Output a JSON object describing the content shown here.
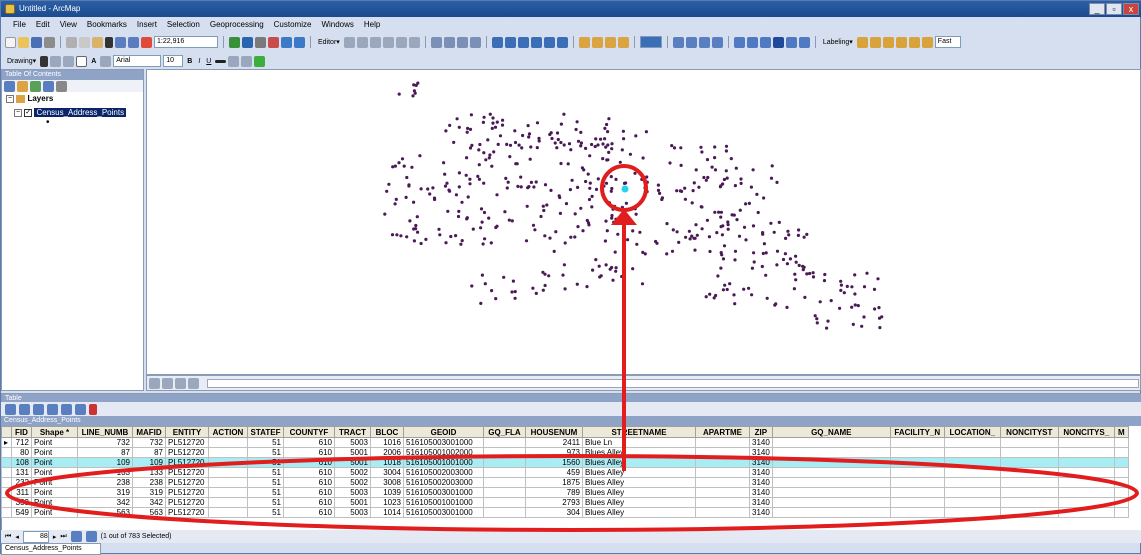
{
  "window": {
    "title": "Untitled - ArcMap",
    "min": "_",
    "max": "▫",
    "close": "x"
  },
  "menu": [
    "File",
    "Edit",
    "View",
    "Bookmarks",
    "Insert",
    "Selection",
    "Geoprocessing",
    "Customize",
    "Windows",
    "Help"
  ],
  "toolbar": {
    "scale": "1:22,916",
    "editor": "Editor▾",
    "drawing": "Drawing▾",
    "font": "Arial",
    "fontsize": "10",
    "labeling": "Labeling▾",
    "fast": "Fast"
  },
  "toc": {
    "title": "Table Of Contents",
    "layers_label": "Layers",
    "layer_name": "Census_Address_Points"
  },
  "table": {
    "title": "Table",
    "tab_title": "Census_Address_Points",
    "columns": [
      "",
      "FID",
      "Shape *",
      "LINE_NUMB",
      "MAFID",
      "ENTITY",
      "ACTION",
      "STATEF",
      "COUNTYF",
      "TRACT",
      "BLOC",
      "GEOID",
      "GQ_FLA",
      "HOUSENUM",
      "STREETNAME",
      "APARTME",
      "ZIP",
      "GQ_NAME",
      "FACILITY_N",
      "LOCATION_",
      "NONCITYST",
      "NONCITYS_",
      "M"
    ],
    "rows": [
      {
        "marker": "▸",
        "fid": "712",
        "shape": "Point",
        "line": "732",
        "mafid": "732",
        "entity": "PL512720",
        "statef": "51",
        "countyf": "610",
        "tract": "5003",
        "bloc": "1016",
        "geoid": "516105003001000",
        "housenum": "2411",
        "street": "Blue Ln",
        "zip": "3140",
        "selected": false
      },
      {
        "marker": "",
        "fid": "80",
        "shape": "Point",
        "line": "87",
        "mafid": "87",
        "entity": "PL512720",
        "statef": "51",
        "countyf": "610",
        "tract": "5001",
        "bloc": "2006",
        "geoid": "516105001002000",
        "housenum": "973",
        "street": "Blues Alley",
        "zip": "3140",
        "selected": false
      },
      {
        "marker": "",
        "fid": "108",
        "shape": "Point",
        "line": "109",
        "mafid": "109",
        "entity": "PL512720",
        "statef": "51",
        "countyf": "610",
        "tract": "5001",
        "bloc": "1018",
        "geoid": "516105001001000",
        "housenum": "1560",
        "street": "Blues Alley",
        "zip": "3140",
        "selected": true
      },
      {
        "marker": "",
        "fid": "131",
        "shape": "Point",
        "line": "133",
        "mafid": "133",
        "entity": "PL512720",
        "statef": "51",
        "countyf": "610",
        "tract": "5002",
        "bloc": "3004",
        "geoid": "516105002003000",
        "housenum": "459",
        "street": "Blues Alley",
        "zip": "3140",
        "selected": false
      },
      {
        "marker": "",
        "fid": "232",
        "shape": "Point",
        "line": "238",
        "mafid": "238",
        "entity": "PL512720",
        "statef": "51",
        "countyf": "610",
        "tract": "5002",
        "bloc": "3008",
        "geoid": "516105002003000",
        "housenum": "1875",
        "street": "Blues Alley",
        "zip": "3140",
        "selected": false
      },
      {
        "marker": "",
        "fid": "311",
        "shape": "Point",
        "line": "319",
        "mafid": "319",
        "entity": "PL512720",
        "statef": "51",
        "countyf": "610",
        "tract": "5003",
        "bloc": "1039",
        "geoid": "516105003001000",
        "housenum": "789",
        "street": "Blues Alley",
        "zip": "3140",
        "selected": false
      },
      {
        "marker": "",
        "fid": "333",
        "shape": "Point",
        "line": "342",
        "mafid": "342",
        "entity": "PL512720",
        "statef": "51",
        "countyf": "610",
        "tract": "5001",
        "bloc": "1023",
        "geoid": "516105001001000",
        "housenum": "2793",
        "street": "Blues Alley",
        "zip": "3140",
        "selected": false
      },
      {
        "marker": "",
        "fid": "549",
        "shape": "Point",
        "line": "563",
        "mafid": "563",
        "entity": "PL512720",
        "statef": "51",
        "countyf": "610",
        "tract": "5003",
        "bloc": "1014",
        "geoid": "516105003001000",
        "housenum": "304",
        "street": "Blues Alley",
        "zip": "3140",
        "selected": false
      }
    ],
    "nav_record": "88",
    "selection_status": "(1 out of 783 Selected)",
    "bottom_tab": "Census_Address_Points"
  },
  "colors": {
    "point": "#4a1a55",
    "selected_point": "#22d3ee",
    "annotation": "#e11d1d",
    "selected_row": "#a8ecf4"
  }
}
